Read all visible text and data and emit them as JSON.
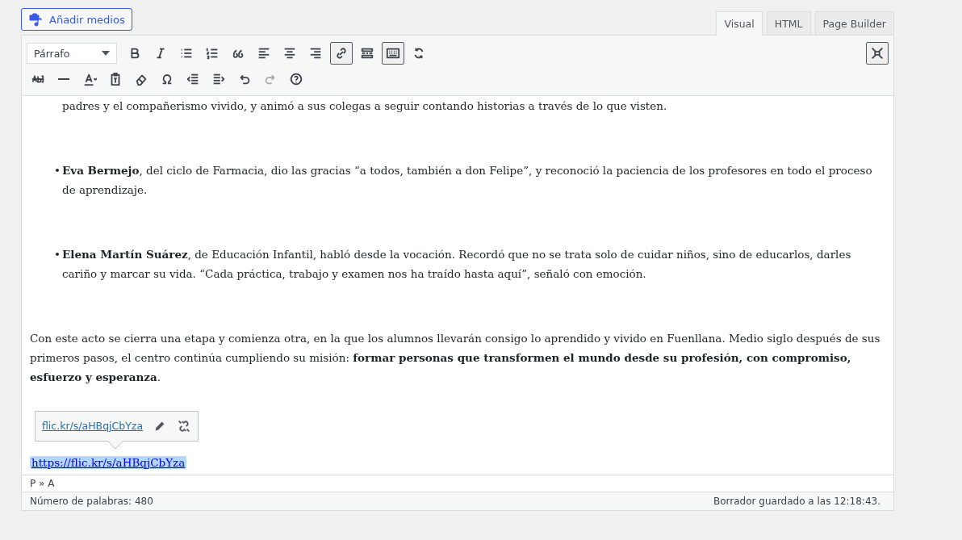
{
  "add_media_button": "Añadir medios",
  "tabs": [
    {
      "label": "Visual",
      "selected": true
    },
    {
      "label": "HTML",
      "selected": false
    },
    {
      "label": "Page Builder",
      "selected": false
    }
  ],
  "format_select": "Párrafo",
  "toolbar_rows": [
    [
      {
        "kind": "bold",
        "pressed": false,
        "disabled": false
      },
      {
        "kind": "italic",
        "pressed": false,
        "disabled": false
      },
      {
        "kind": "bullet-list",
        "pressed": false,
        "disabled": false
      },
      {
        "kind": "numbered-list",
        "pressed": false,
        "disabled": false
      },
      {
        "kind": "quote",
        "pressed": false,
        "disabled": false
      },
      {
        "kind": "align-left",
        "pressed": false,
        "disabled": false
      },
      {
        "kind": "align-center",
        "pressed": false,
        "disabled": false
      },
      {
        "kind": "align-right",
        "pressed": false,
        "disabled": false
      },
      {
        "kind": "link",
        "pressed": true,
        "disabled": false
      },
      {
        "kind": "read-more",
        "pressed": false,
        "disabled": false
      },
      {
        "kind": "keyboard",
        "pressed": true,
        "disabled": false
      },
      {
        "kind": "refresh",
        "pressed": false,
        "disabled": false
      }
    ],
    [
      {
        "kind": "strikethrough",
        "pressed": false,
        "disabled": false
      },
      {
        "kind": "horizontal-line",
        "pressed": false,
        "disabled": false
      },
      {
        "kind": "text-color",
        "pressed": false,
        "disabled": false
      },
      {
        "kind": "paste-text",
        "pressed": false,
        "disabled": false
      },
      {
        "kind": "eraser",
        "pressed": false,
        "disabled": false
      },
      {
        "kind": "omega",
        "pressed": false,
        "disabled": false
      },
      {
        "kind": "outdent",
        "pressed": false,
        "disabled": false
      },
      {
        "kind": "indent",
        "pressed": false,
        "disabled": false
      },
      {
        "kind": "undo",
        "pressed": false,
        "disabled": false
      },
      {
        "kind": "redo",
        "pressed": false,
        "disabled": true
      },
      {
        "kind": "help",
        "pressed": false,
        "disabled": false
      }
    ]
  ],
  "content": [
    {
      "kind": "list-continuation",
      "text": "padres y el compañerismo vivido, y animó a sus colegas a seguir contando historias a través de lo que visten."
    },
    {
      "kind": "list-item",
      "marker": "•",
      "text": "**Eva Bermejo**, del ciclo de Farmacia, dio las gracias “a todos, también a don Felipe”, y reconoció la paciencia de los profesores en todo el proceso de aprendizaje."
    },
    {
      "kind": "list-item",
      "marker": "•",
      "text": "**Elena Martín Suárez**, de Educación Infantil, habló desde la vocación. Recordó que no se trata solo de cuidar niños, sino de educarlos, darles cariño y marcar su vida. “Cada práctica, trabajo y examen nos ha traído hasta aquí”, señaló con emoción."
    },
    {
      "kind": "paragraph",
      "text": "Con este acto se cierra una etapa y comienza otra, en la que los alumnos llevarán consigo lo aprendido y vivido en Fuenllana. Medio siglo después de sus primeros pasos, el centro continúa cumpliendo su misión: **formar personas que transformen el mundo desde su profesión, con compromiso, esfuerzo y esperanza**."
    },
    {
      "kind": "link",
      "text": "https://flic.kr/s/aHBqjCbYza",
      "selected": true
    }
  ],
  "link_popup": {
    "url": "flic.kr/s/aHBqjCbYza"
  },
  "path_bar": "P » A",
  "word_count": "Número de palabras: 480",
  "draft_status": "Borrador guardado a las 12:18:43."
}
